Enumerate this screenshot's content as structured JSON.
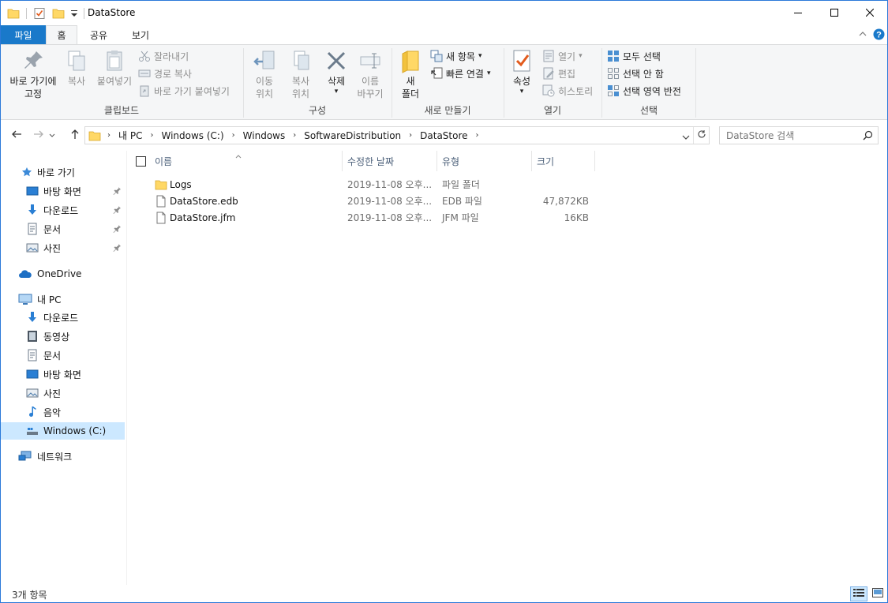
{
  "window": {
    "title": "DataStore",
    "minimize_icon": "minimize-icon",
    "maximize_icon": "maximize-icon",
    "close_icon": "close-icon"
  },
  "ribbon_tabs": [
    {
      "label": "파일"
    },
    {
      "label": "홈"
    },
    {
      "label": "공유"
    },
    {
      "label": "보기"
    }
  ],
  "ribbon": {
    "clipboard": {
      "label": "클립보드",
      "pin_line1": "바로 가기에",
      "pin_line2": "고정",
      "copy": "복사",
      "paste": "붙여넣기",
      "cut": "잘라내기",
      "copy_path": "경로 복사",
      "paste_shortcut": "바로 가기 붙여넣기"
    },
    "organize": {
      "label": "구성",
      "move_line1": "이동",
      "move_line2": "위치",
      "copy_line1": "복사",
      "copy_line2": "위치",
      "delete": "삭제",
      "rename_line1": "이름",
      "rename_line2": "바꾸기"
    },
    "new": {
      "label": "새로 만들기",
      "folder_line1": "새",
      "folder_line2": "폴더",
      "new_item": "새 항목",
      "easy_access": "빠른 연결"
    },
    "open": {
      "label": "열기",
      "properties": "속성",
      "open": "열기",
      "edit": "편집",
      "history": "히스토리"
    },
    "select": {
      "label": "선택",
      "select_all": "모두 선택",
      "select_none": "선택 안 함",
      "invert": "선택 영역 반전"
    }
  },
  "address": {
    "breadcrumbs": [
      "내 PC",
      "Windows (C:)",
      "Windows",
      "SoftwareDistribution",
      "DataStore"
    ],
    "search_placeholder": "DataStore 검색"
  },
  "sidebar": {
    "quick_access": "바로 가기",
    "quick_items": [
      {
        "label": "바탕 화면",
        "icon": "desktop-icon"
      },
      {
        "label": "다운로드",
        "icon": "download-icon"
      },
      {
        "label": "문서",
        "icon": "documents-icon"
      },
      {
        "label": "사진",
        "icon": "pictures-icon"
      }
    ],
    "onedrive": "OneDrive",
    "this_pc": "내 PC",
    "pc_items": [
      {
        "label": "다운로드",
        "icon": "download-icon"
      },
      {
        "label": "동영상",
        "icon": "video-icon"
      },
      {
        "label": "문서",
        "icon": "documents-icon"
      },
      {
        "label": "바탕 화면",
        "icon": "desktop-icon"
      },
      {
        "label": "사진",
        "icon": "pictures-icon"
      },
      {
        "label": "음악",
        "icon": "music-icon"
      },
      {
        "label": "Windows (C:)",
        "icon": "drive-icon"
      }
    ],
    "network": "네트워크"
  },
  "columns": {
    "name": "이름",
    "date": "수정한 날짜",
    "type": "유형",
    "size": "크기"
  },
  "files": [
    {
      "name": "Logs",
      "date": "2019-11-08 오후...",
      "type": "파일 폴더",
      "size": "",
      "icon": "folder-icon"
    },
    {
      "name": "DataStore.edb",
      "date": "2019-11-08 오후...",
      "type": "EDB 파일",
      "size": "47,872KB",
      "icon": "file-icon"
    },
    {
      "name": "DataStore.jfm",
      "date": "2019-11-08 오후...",
      "type": "JFM 파일",
      "size": "16KB",
      "icon": "file-icon"
    }
  ],
  "status": {
    "item_count": "3개 항목"
  },
  "colors": {
    "accent": "#1979ca",
    "selected": "#cce8ff",
    "folder": "#ffd866"
  }
}
